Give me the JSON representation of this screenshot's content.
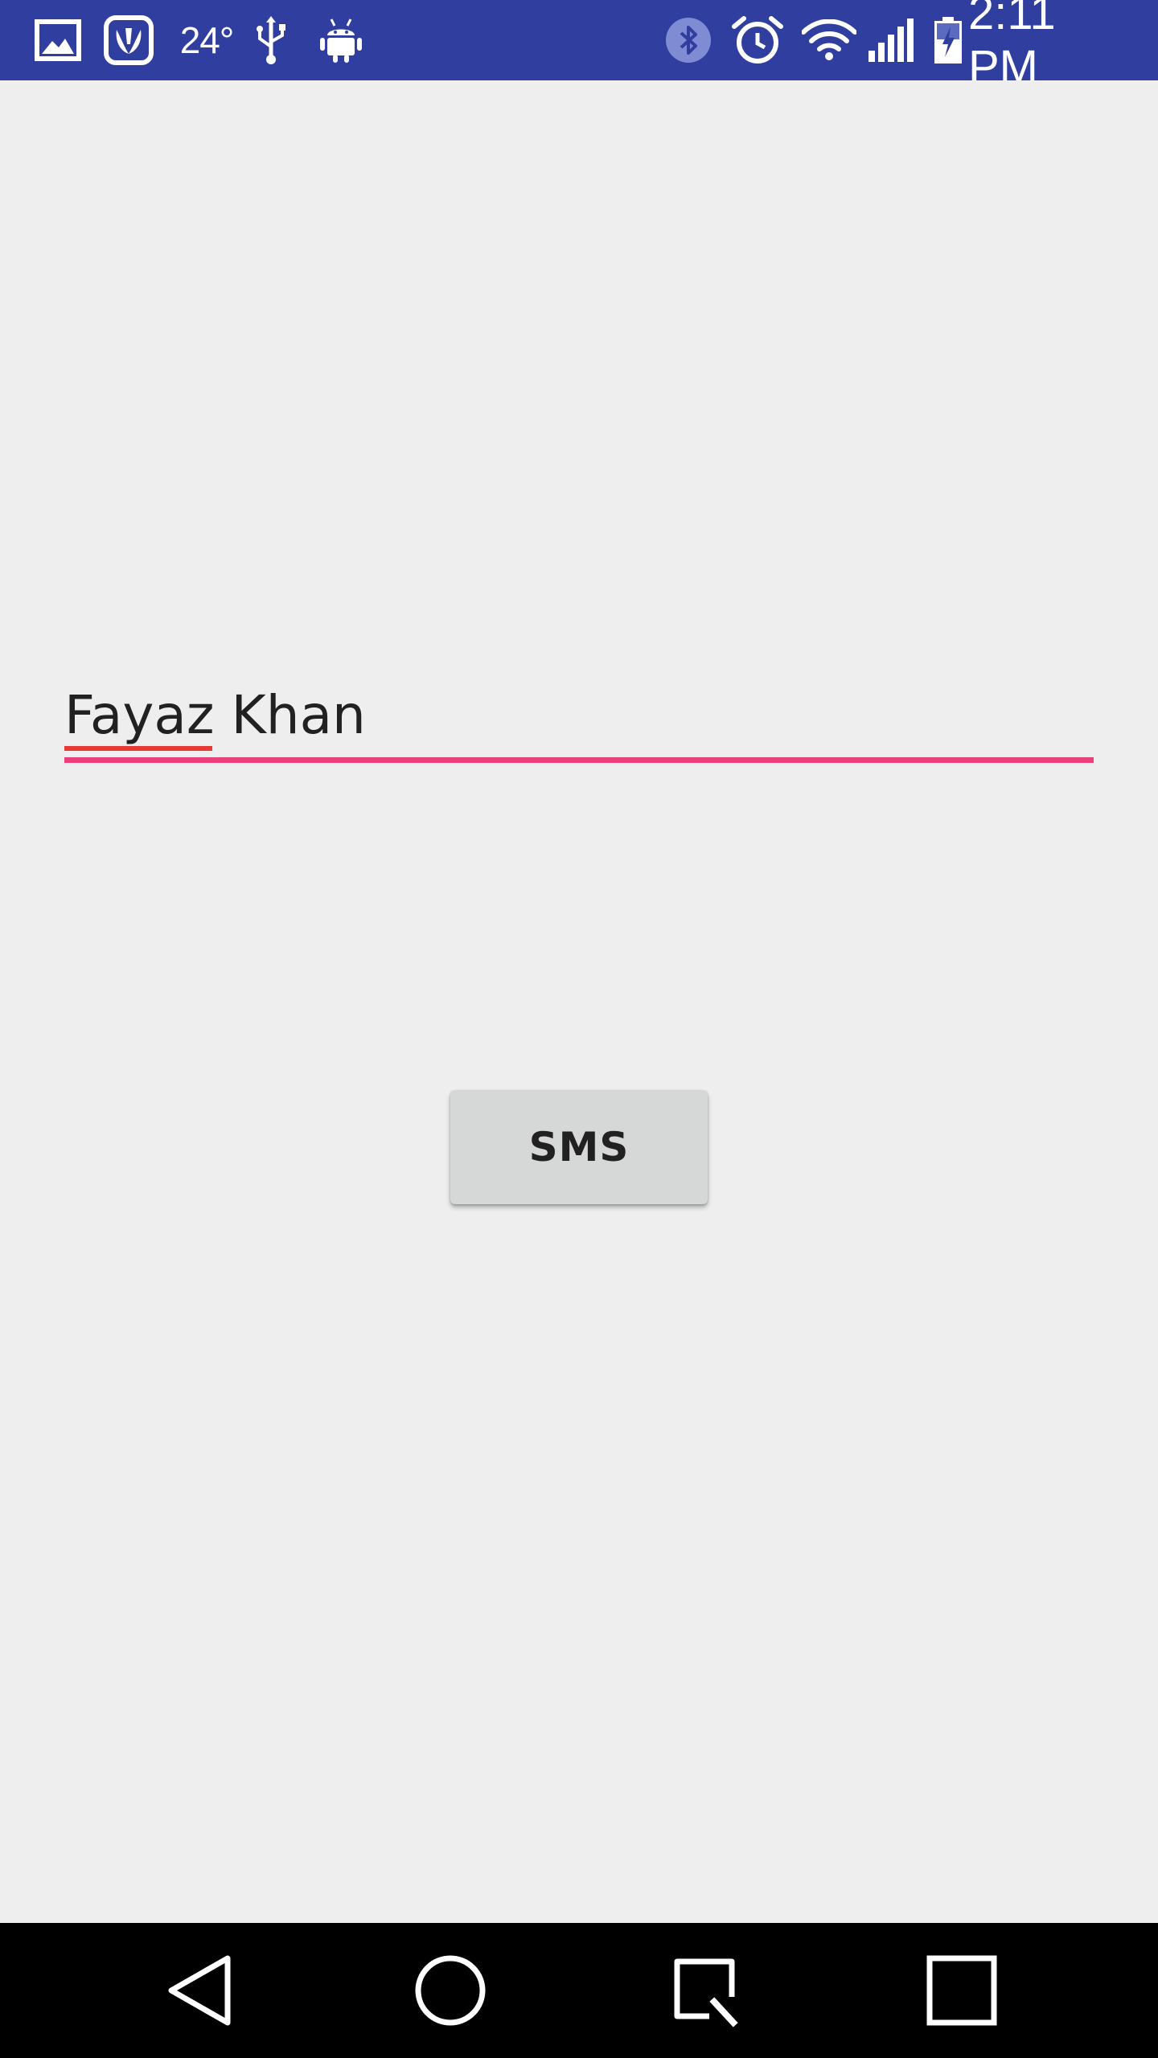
{
  "status_bar": {
    "temperature": "24°",
    "clock": "2:11 PM",
    "background_color": "#303F9F",
    "icons": [
      "gallery-icon",
      "saavn-icon",
      "usb-icon",
      "android-debug-icon",
      "bluetooth-icon",
      "alarm-icon",
      "wifi-icon",
      "signal-icon",
      "battery-charging-icon"
    ]
  },
  "main": {
    "name_field": {
      "value": "Fayaz Khan",
      "accent_color": "#EC407A"
    },
    "sms_button": {
      "label": "SMS"
    }
  },
  "nav_bar": {
    "icons": [
      "back-icon",
      "home-icon",
      "recents-icon",
      "square-icon"
    ]
  }
}
